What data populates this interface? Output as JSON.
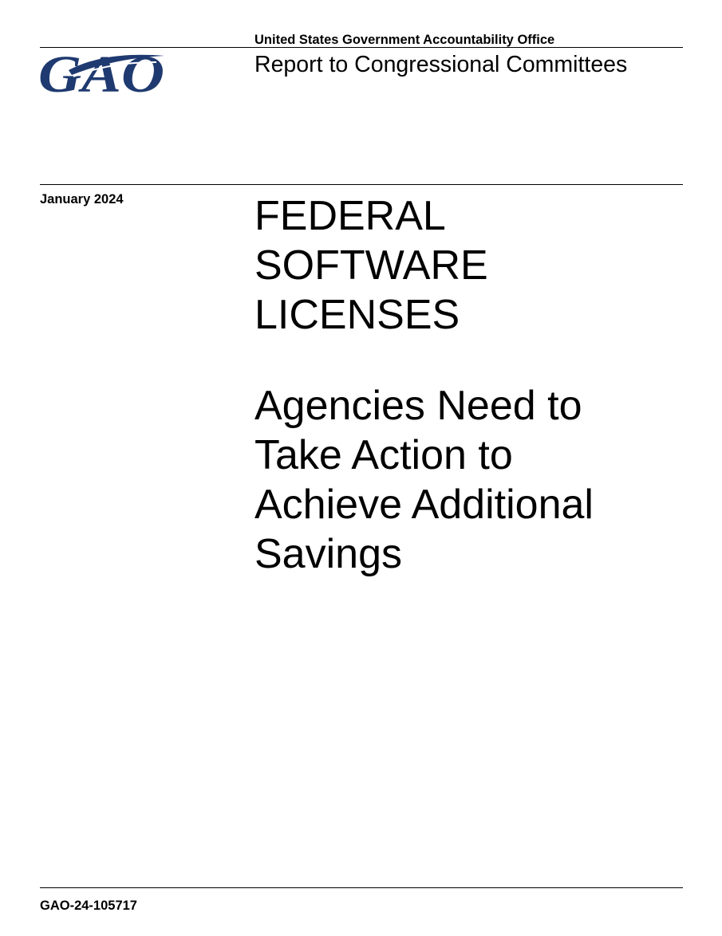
{
  "header": {
    "logo_text": "GAO",
    "agency_name": "United States Government Accountability Office",
    "report_type": "Report to Congressional Committees"
  },
  "date": "January 2024",
  "title_lines": [
    "FEDERAL",
    "SOFTWARE",
    "LICENSES"
  ],
  "subtitle_lines": [
    "Agencies Need to",
    "Take Action to",
    "Achieve Additional",
    "Savings"
  ],
  "footer": {
    "report_number": "GAO-24-105717"
  },
  "colors": {
    "logo_navy": "#1f3a70",
    "logo_swoosh": "#1f3a70",
    "text": "#000000",
    "rules": "#000000"
  }
}
